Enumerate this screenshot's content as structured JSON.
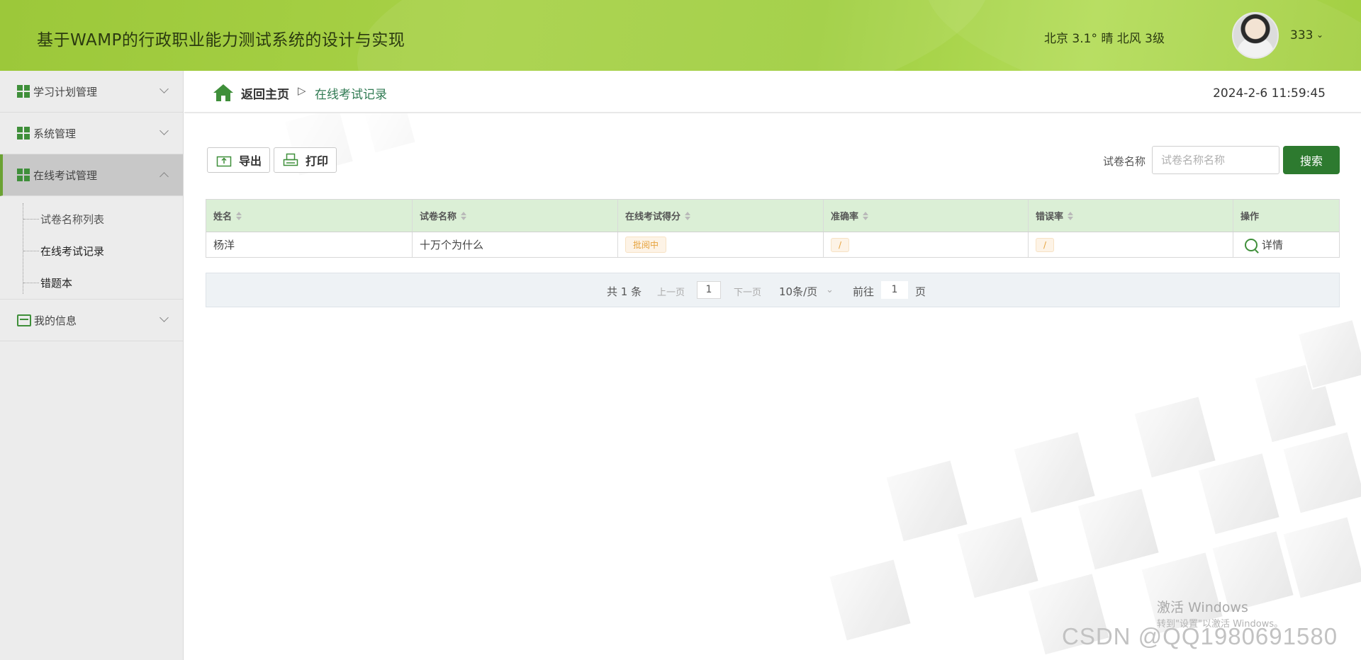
{
  "header": {
    "title": "基于WAMP的行政职业能力测试系统的设计与实现",
    "weather": "北京  3.1°  晴  北风  3级",
    "user_name": "333",
    "caret": "⌄"
  },
  "sidebar": {
    "items": [
      {
        "label": "学习计划管理",
        "icon": "grid-icon",
        "expanded": false
      },
      {
        "label": "系统管理",
        "icon": "grid-icon",
        "expanded": false
      },
      {
        "label": "在线考试管理",
        "icon": "grid-icon",
        "expanded": true
      },
      {
        "label": "我的信息",
        "icon": "wallet-icon",
        "expanded": false
      }
    ],
    "submenu": [
      {
        "label": "试卷名称列表"
      },
      {
        "label": "在线考试记录"
      },
      {
        "label": "错题本"
      }
    ]
  },
  "breadcrumb": {
    "home": "返回主页",
    "separator": "▷",
    "current": "在线考试记录"
  },
  "clock": "2024-2-6 11:59:45",
  "toolbar": {
    "export_label": "导出",
    "print_label": "打印"
  },
  "search": {
    "label": "试卷名称",
    "placeholder": "试卷名称名称",
    "button": "搜索"
  },
  "table": {
    "headers": [
      "姓名",
      "试卷名称",
      "在线考试得分",
      "准确率",
      "错误率",
      "操作"
    ],
    "rows": [
      {
        "name": "杨洋",
        "paper": "十万个为什么",
        "score": "批阅中",
        "accuracy": "/",
        "error_rate": "/",
        "action": "详情"
      }
    ]
  },
  "pager": {
    "total": "共 1 条",
    "prev": "上一页",
    "page": "1",
    "next": "下一页",
    "page_size": "10条/页",
    "goto_prefix": "前往",
    "goto_page": "1",
    "goto_suffix": "页"
  },
  "watermarks": {
    "windows_line1": "激活 Windows",
    "windows_line2": "转到\"设置\"以激活 Windows。",
    "csdn": "CSDN @QQ1980691580"
  },
  "colors": {
    "header_green": "#a3cf43",
    "accent_green": "#2d7a2f",
    "table_header_bg": "#dbefd6",
    "status_orange": "#e6a23c"
  }
}
